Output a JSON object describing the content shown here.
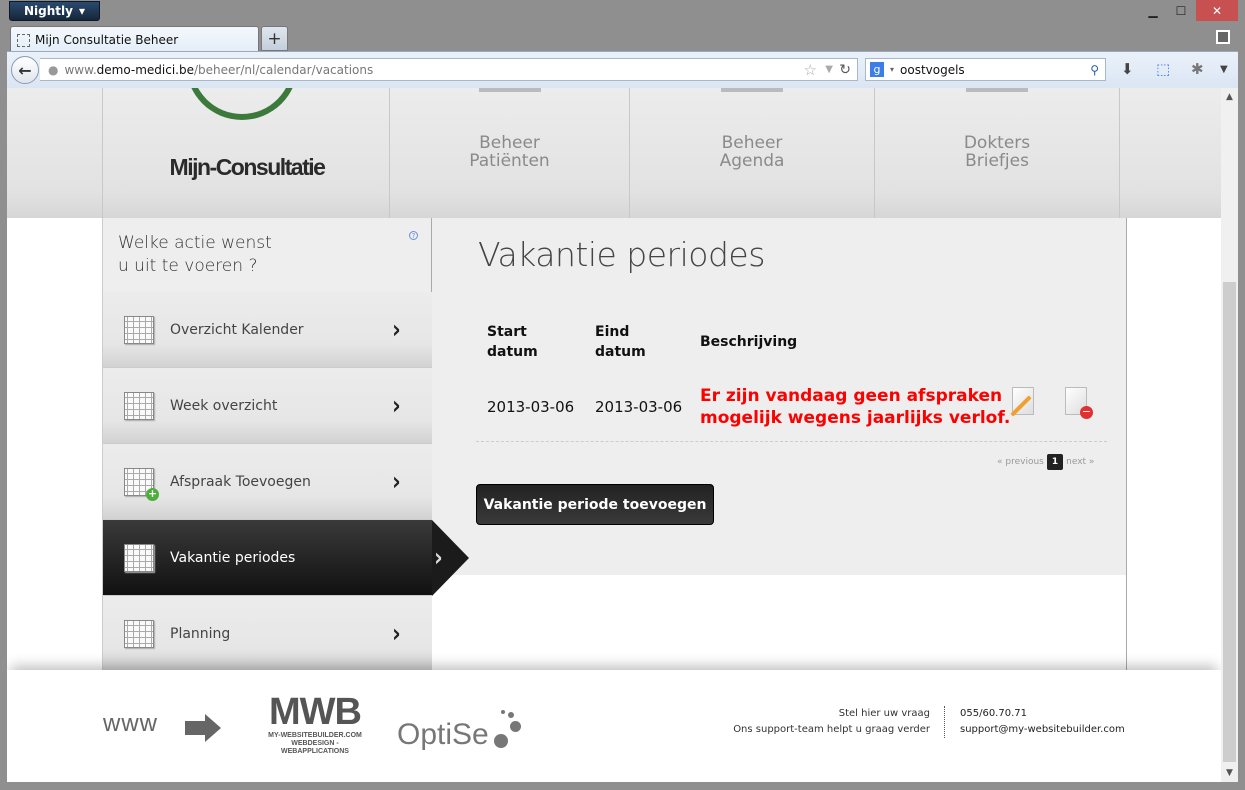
{
  "browser": {
    "app_menu": "Nightly",
    "tab_title": "Mijn Consultatie Beheer",
    "new_tab": "+",
    "url_prefix": "www.",
    "url_domain": "demo-medici.be",
    "url_path": "/beheer/nl/calendar/vacations",
    "search_value": "oostvogels",
    "search_engine": "g"
  },
  "header": {
    "logo_text": "Mijn-Consultatie",
    "nav": [
      {
        "line1": "Beheer",
        "line2": "Patiënten"
      },
      {
        "line1": "Beheer",
        "line2": "Agenda"
      },
      {
        "line1": "Dokters",
        "line2": "Briefjes"
      }
    ]
  },
  "sidebar": {
    "title_line1": "Welke actie wenst",
    "title_line2": "u uit te voeren ?",
    "help": "?",
    "items": [
      {
        "label": "Overzicht Kalender"
      },
      {
        "label": "Week overzicht"
      },
      {
        "label": "Afspraak Toevoegen"
      },
      {
        "label": "Vakantie periodes",
        "active": true
      },
      {
        "label": "Planning"
      }
    ],
    "chevron": "›"
  },
  "main": {
    "title": "Vakantie periodes",
    "columns": [
      "Start datum",
      "Eind datum",
      "Beschrijving"
    ],
    "col_start_1": "Start",
    "col_start_2": "datum",
    "col_end_1": "Eind",
    "col_end_2": "datum",
    "rows": [
      {
        "start": "2013-03-06",
        "end": "2013-03-06",
        "desc_line1": "Er zijn vandaag geen afspraken",
        "desc_line2": "mogelijk wegens jaarlijks verlof."
      }
    ],
    "pager": {
      "previous": "« previous",
      "current": "1",
      "next": "next »"
    },
    "add_button": "Vakantie periode toevoegen",
    "desc_color": "#ff0000"
  },
  "footer": {
    "www": "www",
    "mwb_logo": "MWB",
    "mwb_line1": "MY-WEBSITEBUILDER.COM",
    "mwb_line2": "WEBDESIGN - WEBAPPLICATIONS",
    "optise": "OptiSe",
    "support_line1": "Stel hier uw vraag",
    "support_line2": "Ons support-team helpt u graag verder",
    "phone": "055/60.70.71",
    "email": "support@my-websitebuilder.com"
  }
}
